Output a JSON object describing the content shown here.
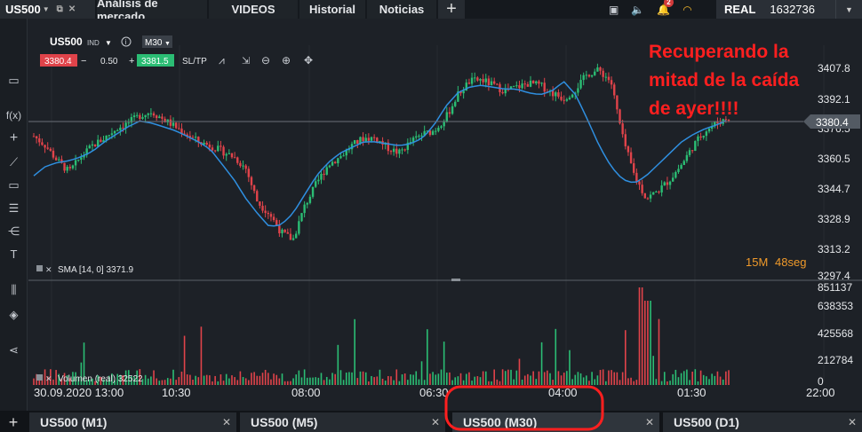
{
  "topbar": {
    "instrument": "US500",
    "tabs": [
      "Análisis de mercado",
      "VIDEOS",
      "Historial",
      "Noticias"
    ],
    "notification_count": "2",
    "account_mode": "REAL",
    "account_number": "1632736"
  },
  "chart_header": {
    "symbol": "US500",
    "ind_label": "IND",
    "timeframe": "M30",
    "sell_price": "3380.4",
    "spread": "0.50",
    "buy_price": "3381.5",
    "sltp_label": "SL/TP"
  },
  "indicators": {
    "sma_label": "SMA [14, 0] 3371.9",
    "volume_label": "Volumen (real) 32522"
  },
  "countdown": {
    "minutes": "15M",
    "seconds": "48seg"
  },
  "annotation": {
    "line1": "Recuperando la",
    "line2": "mitad de la caída",
    "line3": "de ayer!!!!"
  },
  "price_axis": {
    "labels": [
      "3407.8",
      "3392.1",
      "3376.5",
      "3360.5",
      "3344.7",
      "3328.9",
      "3313.2",
      "3297.4"
    ],
    "current_price": "3380.4"
  },
  "volume_axis": {
    "labels": [
      "851137",
      "638353",
      "425568",
      "212784",
      "0"
    ]
  },
  "time_axis": {
    "labels": [
      "30.09.2020 13:00",
      "10:30",
      "08:00",
      "06:30",
      "04:00",
      "01:30",
      "22:00"
    ]
  },
  "bottom_tabs": [
    "US500 (M1)",
    "US500 (M5)",
    "US500 (M30)",
    "US500 (D1)"
  ],
  "colors": {
    "up": "#2bbd74",
    "down": "#e0434a",
    "sma": "#2f8fe0",
    "annotation": "#ff1f1f",
    "countdown": "#f09a2a"
  },
  "chart_data": {
    "type": "candlestick",
    "series": [
      {
        "name": "SMA [14, 0]"
      }
    ],
    "ylim": [
      3297.4,
      3415.0
    ],
    "volume_ylim": [
      0,
      900000
    ],
    "close_trail": [
      3371,
      3366,
      3358,
      3352,
      3360,
      3366,
      3370,
      3375,
      3378,
      3382,
      3384,
      3380,
      3376,
      3372,
      3368,
      3366,
      3363,
      3360,
      3354,
      3336,
      3330,
      3320,
      3316,
      3334,
      3346,
      3356,
      3360,
      3366,
      3370,
      3370,
      3365,
      3362,
      3368,
      3372,
      3374,
      3381,
      3393,
      3400,
      3401,
      3398,
      3395,
      3397,
      3399,
      3398,
      3394,
      3391,
      3396,
      3404,
      3406,
      3400,
      3370,
      3350,
      3338,
      3342,
      3348,
      3356,
      3366,
      3374,
      3378,
      3381
    ],
    "sma_trail": [
      3350,
      3355,
      3357,
      3358,
      3360,
      3363,
      3368,
      3372,
      3376,
      3379,
      3378,
      3376,
      3374,
      3371,
      3368,
      3364,
      3356,
      3348,
      3338,
      3330,
      3323,
      3324,
      3330,
      3340,
      3350,
      3357,
      3362,
      3365,
      3368,
      3368,
      3367,
      3366,
      3367,
      3370,
      3377,
      3387,
      3394,
      3397,
      3398,
      3397,
      3396,
      3396,
      3394,
      3393,
      3395,
      3400,
      3393,
      3380,
      3366,
      3355,
      3348,
      3346,
      3350,
      3356,
      3362,
      3368,
      3372,
      3375,
      3377,
      3380
    ]
  }
}
